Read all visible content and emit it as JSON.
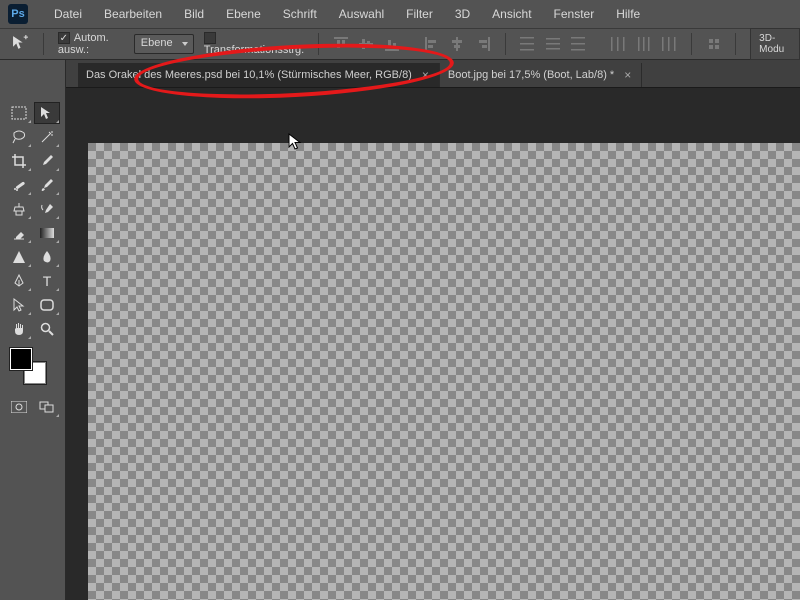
{
  "app": {
    "logo": "Ps"
  },
  "menu": [
    "Datei",
    "Bearbeiten",
    "Bild",
    "Ebene",
    "Schrift",
    "Auswahl",
    "Filter",
    "3D",
    "Ansicht",
    "Fenster",
    "Hilfe"
  ],
  "options": {
    "auto_select_label": "Autom. ausw.:",
    "auto_select_checked": true,
    "target_dropdown": "Ebene",
    "transform_label": "Transformationsstrg.",
    "transform_checked": false,
    "mode3d": "3D-Modu"
  },
  "tabs": [
    {
      "label": "Das Orakel des Meeres.psd bei 10,1%  (Stürmisches Meer, RGB/8)",
      "active": true
    },
    {
      "label": "Boot.jpg bei 17,5% (Boot, Lab/8) *",
      "active": false
    }
  ],
  "tools": {
    "left_col": [
      "marquee",
      "lasso",
      "crop",
      "eyedropper-alt",
      "healing",
      "eraser",
      "pen-triangle",
      "pen",
      "path-select",
      "hand"
    ],
    "right_col": [
      "move",
      "magic-wand",
      "eyedropper",
      "brush",
      "clone",
      "gradient",
      "blur",
      "type",
      "rounded-rect",
      "zoom"
    ]
  }
}
